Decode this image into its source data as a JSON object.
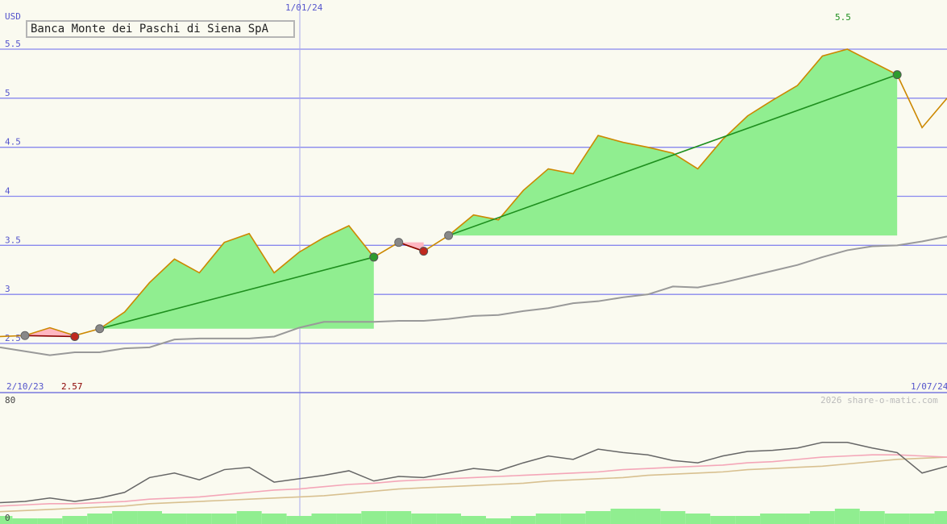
{
  "title": "Banca Monte dei Paschi di Siena SpA",
  "currency": "USD",
  "dates": {
    "start": "2/10/23",
    "mid": "1/01/24",
    "end": "1/07/24"
  },
  "annotations": {
    "high": "5.5",
    "low": "2.57"
  },
  "copyright": "2026 share-o-matic.com",
  "indicator_labels": {
    "top": "80",
    "bottom": "0"
  },
  "colors": {
    "price": "#cc8800",
    "gain_fill": "#90ee90",
    "loss_fill": "#ffb6c1",
    "trend_gain": "#1e8f1e",
    "trend_loss": "#8b0000",
    "moving_average": "#999999",
    "grid": "#8888ee",
    "osc": "#666666",
    "osc_pink": "#f4a6b8",
    "osc_tan": "#d8c090",
    "volume": "#90ee90"
  },
  "chart_data": {
    "type": "line",
    "ylim": [
      2.5,
      5.5
    ],
    "yticks": [
      "2.5",
      "3",
      "3.5",
      "4",
      "4.5",
      "5",
      "5.5"
    ],
    "x": [
      0,
      1,
      2,
      3,
      4,
      5,
      6,
      7,
      8,
      9,
      10,
      11,
      12,
      13,
      14,
      15,
      16,
      17,
      18,
      19,
      20,
      21,
      22,
      23,
      24,
      25,
      26,
      27,
      28,
      29,
      30,
      31,
      32,
      33,
      34,
      35,
      36,
      37,
      38
    ],
    "price": [
      2.57,
      2.58,
      2.66,
      2.58,
      2.65,
      2.82,
      3.12,
      3.36,
      3.22,
      3.53,
      3.62,
      3.22,
      3.43,
      3.58,
      3.7,
      3.38,
      3.53,
      3.44,
      3.6,
      3.81,
      3.76,
      4.06,
      4.28,
      4.23,
      4.62,
      4.55,
      4.5,
      4.44,
      4.28,
      4.58,
      4.82,
      4.98,
      5.13,
      5.43,
      5.5,
      5.37,
      5.24,
      4.7,
      5.0
    ],
    "moving_average": [
      2.46,
      2.42,
      2.38,
      2.41,
      2.41,
      2.45,
      2.46,
      2.54,
      2.55,
      2.55,
      2.55,
      2.57,
      2.66,
      2.72,
      2.72,
      2.72,
      2.73,
      2.73,
      2.75,
      2.78,
      2.79,
      2.83,
      2.86,
      2.91,
      2.93,
      2.97,
      3.0,
      3.08,
      3.07,
      3.12,
      3.18,
      3.24,
      3.3,
      3.38,
      3.45,
      3.49,
      3.5,
      3.54,
      3.59
    ],
    "trades": [
      {
        "entry_index": 1,
        "exit_index": 3,
        "entry_price": 2.58,
        "exit_price": 2.57,
        "result": "loss"
      },
      {
        "entry_index": 4,
        "exit_index": 15,
        "entry_price": 2.65,
        "exit_price": 3.38,
        "result": "gain"
      },
      {
        "entry_index": 16,
        "exit_index": 17,
        "entry_price": 3.53,
        "exit_price": 3.44,
        "result": "loss"
      },
      {
        "entry_index": 18,
        "exit_index": 36,
        "entry_price": 3.6,
        "exit_price": 5.24,
        "result": "gain"
      }
    ],
    "indicator": {
      "ylim": [
        0,
        100
      ],
      "osc": [
        16,
        17,
        20,
        17,
        20,
        25,
        38,
        42,
        36,
        45,
        47,
        34,
        37,
        40,
        44,
        35,
        39,
        38,
        42,
        46,
        44,
        51,
        57,
        54,
        63,
        60,
        58,
        53,
        51,
        57,
        61,
        62,
        64,
        69,
        69,
        64,
        60,
        42,
        48
      ],
      "osc_ma_pink": [
        13,
        14,
        15,
        15,
        16,
        17,
        19,
        20,
        21,
        23,
        25,
        27,
        28,
        30,
        32,
        33,
        35,
        36,
        37,
        38,
        39,
        40,
        41,
        42,
        43,
        45,
        46,
        47,
        48,
        49,
        51,
        52,
        54,
        56,
        57,
        58,
        58,
        57,
        56
      ],
      "osc_ma_tan": [
        8,
        9,
        10,
        11,
        12,
        13,
        15,
        16,
        17,
        18,
        19,
        20,
        21,
        22,
        24,
        26,
        28,
        29,
        30,
        31,
        32,
        33,
        35,
        36,
        37,
        38,
        40,
        41,
        42,
        43,
        45,
        46,
        47,
        48,
        50,
        52,
        54,
        55,
        56
      ],
      "volume": [
        2,
        1,
        1,
        2,
        3,
        4,
        4,
        3,
        3,
        3,
        4,
        3,
        2,
        3,
        3,
        4,
        4,
        3,
        3,
        2,
        1,
        2,
        3,
        3,
        4,
        5,
        5,
        4,
        3,
        2,
        2,
        3,
        3,
        4,
        5,
        4,
        3,
        3,
        4
      ]
    }
  }
}
